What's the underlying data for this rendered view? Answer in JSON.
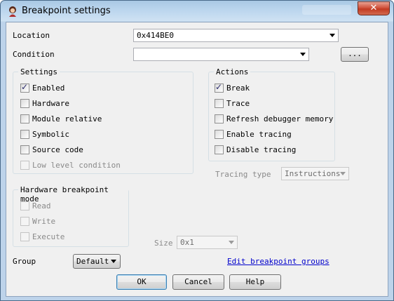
{
  "window": {
    "title": "Breakpoint settings",
    "close_glyph": "✕",
    "app_icon": "debugger-app-icon"
  },
  "location": {
    "label": "Location",
    "value": "0x414BE0"
  },
  "condition": {
    "label": "Condition",
    "value": "",
    "browse_label": "..."
  },
  "settings": {
    "legend": "Settings",
    "items": [
      {
        "label": "Enabled",
        "checked": true,
        "enabled": true
      },
      {
        "label": "Hardware",
        "checked": false,
        "enabled": true
      },
      {
        "label": "Module relative",
        "checked": false,
        "enabled": true
      },
      {
        "label": "Symbolic",
        "checked": false,
        "enabled": true
      },
      {
        "label": "Source code",
        "checked": false,
        "enabled": true
      },
      {
        "label": "Low level condition",
        "checked": false,
        "enabled": false
      }
    ]
  },
  "actions": {
    "legend": "Actions",
    "items": [
      {
        "label": "Break",
        "checked": true,
        "enabled": true
      },
      {
        "label": "Trace",
        "checked": false,
        "enabled": true
      },
      {
        "label": "Refresh debugger memory",
        "checked": false,
        "enabled": true
      },
      {
        "label": "Enable tracing",
        "checked": false,
        "enabled": true
      },
      {
        "label": "Disable tracing",
        "checked": false,
        "enabled": true
      }
    ]
  },
  "tracing_type": {
    "label": "Tracing type",
    "value": "Instructions"
  },
  "hardware_mode": {
    "legend": "Hardware breakpoint mode",
    "items": [
      {
        "label": "Read",
        "checked": false,
        "enabled": false
      },
      {
        "label": "Write",
        "checked": false,
        "enabled": false
      },
      {
        "label": "Execute",
        "checked": false,
        "enabled": false
      }
    ]
  },
  "size": {
    "label": "Size",
    "value": "0x1"
  },
  "group": {
    "label": "Group",
    "value": "Default"
  },
  "edit_groups_link": "Edit breakpoint groups",
  "buttons": {
    "ok": "OK",
    "cancel": "Cancel",
    "help": "Help"
  },
  "colors": {
    "link": "#0000cc",
    "close_button": "#c23b22",
    "frame": "#bdd3ea"
  }
}
